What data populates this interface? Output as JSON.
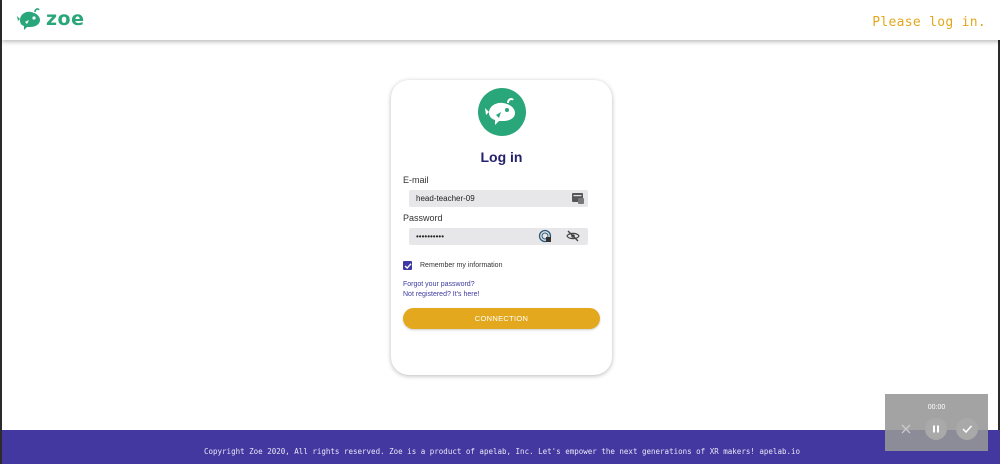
{
  "header": {
    "brand": "zoe",
    "message": "Please log in."
  },
  "login": {
    "title": "Log in",
    "email_label": "E-mail",
    "email_value": "head-teacher-09",
    "password_label": "Password",
    "password_value": "••••••••••",
    "remember_label": "Remember my information",
    "remember_checked": true,
    "forgot_link": "Forgot your password?",
    "register_link": "Not registered? It's here!",
    "connect_button": "CONNECTION"
  },
  "footer": {
    "text": "Copyright Zoe 2020, All rights reserved. Zoe is a product of apelab, Inc. Let's empower the next generations of XR makers! apelab.io"
  },
  "recorder": {
    "time": "00:00"
  },
  "colors": {
    "brand_green": "#2aa67b",
    "accent_yellow": "#e3a81e",
    "footer_purple": "#4338a0",
    "title_navy": "#24226b"
  }
}
